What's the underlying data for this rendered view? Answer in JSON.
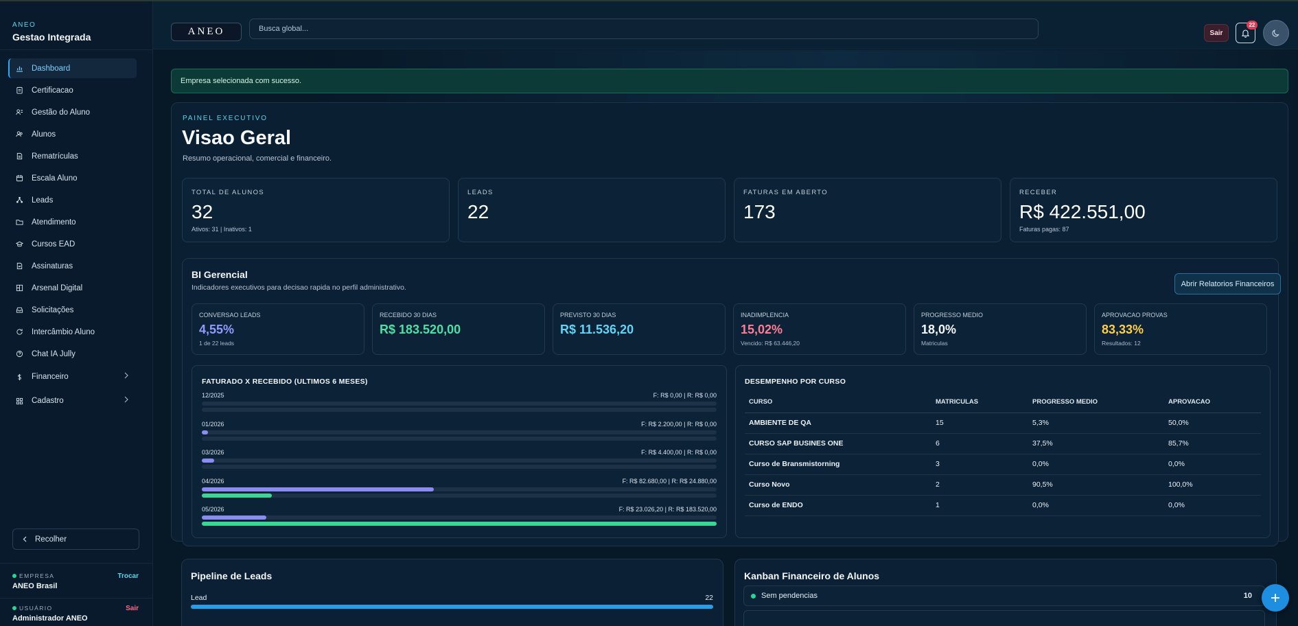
{
  "sidebar": {
    "brand_small": "ANEO",
    "brand_title": "Gestao Integrada",
    "items": [
      {
        "label": "Dashboard",
        "icon": "chart-bar-icon"
      },
      {
        "label": "Certificacao",
        "icon": "clipboard-icon"
      },
      {
        "label": "Gestão do Aluno",
        "icon": "users-icon"
      },
      {
        "label": "Alunos",
        "icon": "user-group-icon"
      },
      {
        "label": "Rematrículas",
        "icon": "document-icon"
      },
      {
        "label": "Escala Aluno",
        "icon": "calendar-icon"
      },
      {
        "label": "Leads",
        "icon": "network-icon"
      },
      {
        "label": "Atendimento",
        "icon": "folder-icon"
      },
      {
        "label": "Cursos EAD",
        "icon": "graduation-cap-icon"
      },
      {
        "label": "Assinaturas",
        "icon": "signature-icon"
      },
      {
        "label": "Arsenal Digital",
        "icon": "grid-book-icon"
      },
      {
        "label": "Solicitações",
        "icon": "inbox-icon"
      },
      {
        "label": "Intercâmbio Aluno",
        "icon": "refresh-icon"
      },
      {
        "label": "Chat IA Jully",
        "icon": "help-circle-icon"
      },
      {
        "label": "Financeiro",
        "icon": "dollar-icon"
      },
      {
        "label": "Cadastro",
        "icon": "grid-icon"
      }
    ],
    "collapse_label": "Recolher",
    "company_label": "EMPRESA",
    "company_value": "ANEO Brasil",
    "company_action": "Trocar",
    "user_label": "USUÁRIO",
    "user_value": "Administrador ANEO",
    "user_action": "Sair"
  },
  "header": {
    "logo": "ANEO",
    "search_placeholder": "Busca global...",
    "logout_label": "Sair",
    "notification_count": "22"
  },
  "alert": "Empresa selecionada com sucesso.",
  "overview": {
    "eyebrow": "PAINEL EXECUTIVO",
    "title": "Visao Geral",
    "subtitle": "Resumo operacional, comercial e financeiro.",
    "kpis": [
      {
        "label": "TOTAL DE ALUNOS",
        "value": "32",
        "sub": "Ativos: 31 | Inativos: 1"
      },
      {
        "label": "LEADS",
        "value": "22",
        "sub": ""
      },
      {
        "label": "FATURAS EM ABERTO",
        "value": "173",
        "sub": ""
      },
      {
        "label": "RECEBER",
        "value": "R$ 422.551,00",
        "sub": "Faturas pagas: 87"
      }
    ]
  },
  "bi": {
    "title": "BI Gerencial",
    "subtitle": "Indicadores executivos para decisao rapida no perfil administrativo.",
    "button": "Abrir Relatorios Financeiros",
    "cards": [
      {
        "label": "CONVERSAO LEADS",
        "value": "4,55%",
        "sub": "1 de 22 leads",
        "color": "#8f9bff"
      },
      {
        "label": "RECEBIDO 30 DIAS",
        "value": "R$ 183.520,00",
        "sub": "",
        "color": "#4fe0a6"
      },
      {
        "label": "PREVISTO 30 DIAS",
        "value": "R$ 11.536,20",
        "sub": "",
        "color": "#62d4f6"
      },
      {
        "label": "INADIMPLENCIA",
        "value": "15,02%",
        "sub": "Vencido: R$ 63.446,20",
        "color": "#ff7d95"
      },
      {
        "label": "PROGRESSO MEDIO",
        "value": "18,0%",
        "sub": "Matriculas",
        "color": "#f3f7fb"
      },
      {
        "label": "APROVACAO PROVAS",
        "value": "83,33%",
        "sub": "Resultados: 12",
        "color": "#ffce4a"
      }
    ]
  },
  "chart_data": {
    "type": "bar",
    "title": "FATURADO X RECEBIDO (ULTIMOS 6 MESES)",
    "categories": [
      "12/2025",
      "01/2026",
      "03/2026",
      "04/2026",
      "05/2026"
    ],
    "labels": [
      "F: R$ 0,00 | R: R$ 0,00",
      "F: R$ 2.200,00 | R: R$ 0,00",
      "F: R$ 4.400,00 | R: R$ 0,00",
      "F: R$ 82.680,00 | R: R$ 24.880,00",
      "F: R$ 23.026,20 | R: R$ 183.520,00"
    ],
    "series": [
      {
        "name": "F",
        "values": [
          0,
          2200,
          4400,
          82680,
          23026.2
        ],
        "color": "#8a8cf0"
      },
      {
        "name": "R",
        "values": [
          0,
          0,
          0,
          24880,
          183520
        ],
        "color": "#3dd596"
      }
    ],
    "max": 183520
  },
  "performance": {
    "title": "DESEMPENHO POR CURSO",
    "columns": [
      "CURSO",
      "MATRICULAS",
      "PROGRESSO MEDIO",
      "APROVACAO"
    ],
    "rows": [
      [
        "AMBIENTE DE QA",
        "15",
        "5,3%",
        "50,0%"
      ],
      [
        "CURSO SAP BUSINES ONE",
        "6",
        "37,5%",
        "85,7%"
      ],
      [
        "Curso de Bransmistorning",
        "3",
        "0,0%",
        "0,0%"
      ],
      [
        "Curso Novo",
        "2",
        "90,5%",
        "100,0%"
      ],
      [
        "Curso de ENDO",
        "1",
        "0,0%",
        "0,0%"
      ]
    ]
  },
  "pipeline": {
    "title": "Pipeline de Leads",
    "stages": [
      {
        "label": "Lead",
        "count": "22",
        "fraction": 1.0
      }
    ]
  },
  "kanban": {
    "title": "Kanban Financeiro de Alunos",
    "columns": [
      {
        "label": "Sem pendencias",
        "count": "10"
      }
    ]
  }
}
